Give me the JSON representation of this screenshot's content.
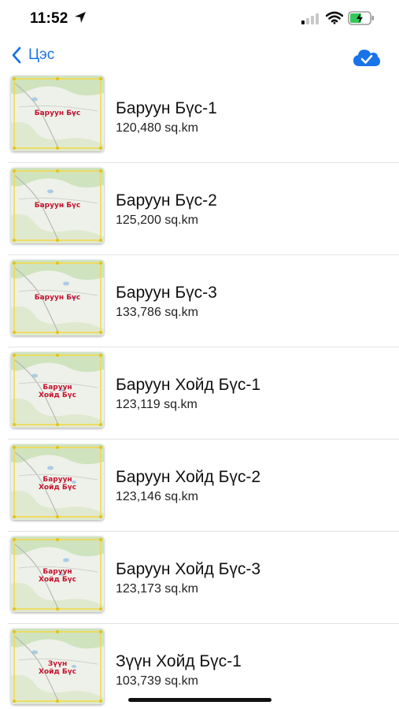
{
  "status_bar": {
    "time": "11:52"
  },
  "nav": {
    "back_label": "Цэс",
    "accent_color": "#1a73e8"
  },
  "items": [
    {
      "title": "Баруун Бүс-1",
      "area": "120,480 sq.km",
      "map_label": [
        "Баруун Бүс"
      ]
    },
    {
      "title": "Баруун Бүс-2",
      "area": "125,200 sq.km",
      "map_label": [
        "Баруун Бүс"
      ]
    },
    {
      "title": "Баруун Бүс-3",
      "area": "133,786 sq.km",
      "map_label": [
        "Баруун Бүс"
      ]
    },
    {
      "title": "Баруун Хойд Бүс-1",
      "area": "123,119 sq.km",
      "map_label": [
        "Баруун",
        "Хойд Бүс"
      ]
    },
    {
      "title": "Баруун Хойд Бүс-2",
      "area": "123,146 sq.km",
      "map_label": [
        "Баруун",
        "Хойд Бүс"
      ]
    },
    {
      "title": "Баруун Хойд Бүс-3",
      "area": "123,173 sq.km",
      "map_label": [
        "Баруун",
        "Хойд Бүс"
      ]
    },
    {
      "title": "Зүүн Хойд Бүс-1",
      "area": "103,739 sq.km",
      "map_label": [
        "Зүүн",
        "Хойд Бүс"
      ]
    }
  ]
}
